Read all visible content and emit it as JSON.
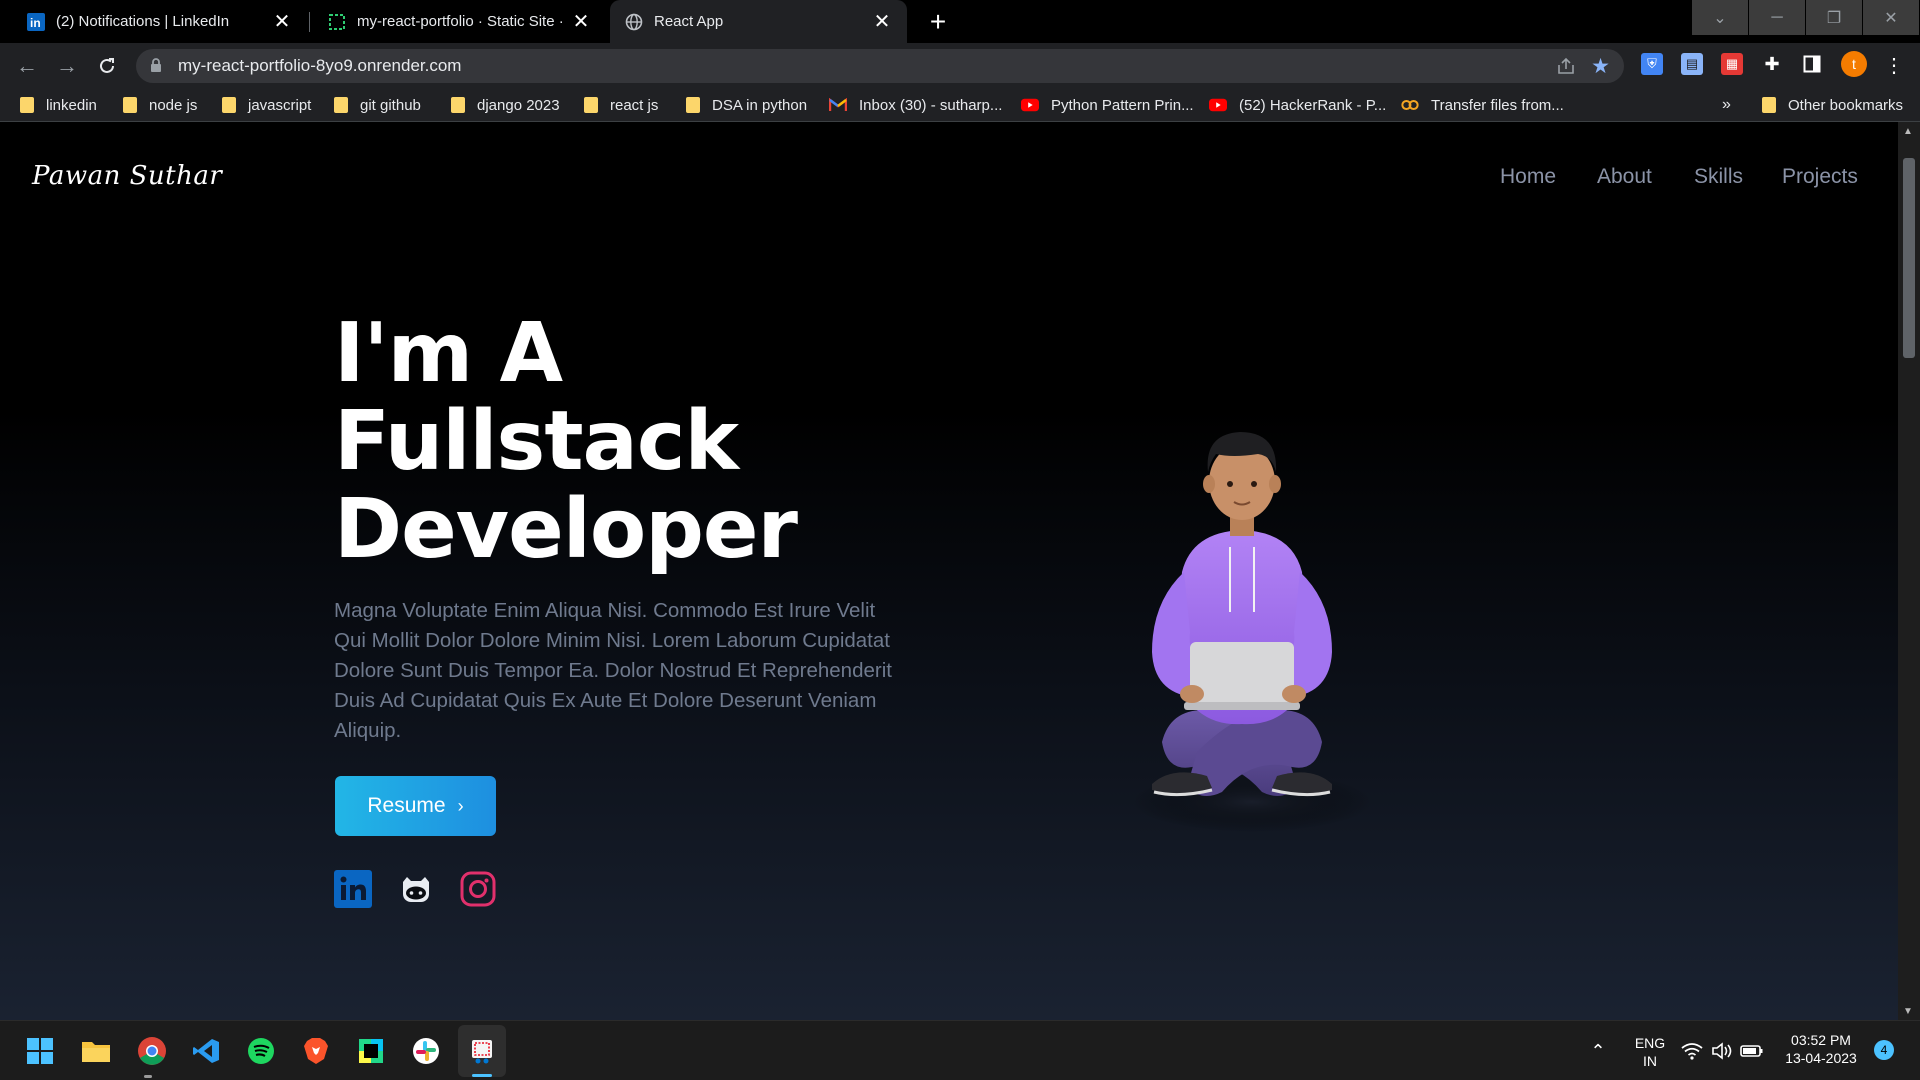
{
  "browser": {
    "tabs": [
      {
        "title": "(2) Notifications | LinkedIn",
        "favicon": "linkedin-icon"
      },
      {
        "title": "my-react-portfolio · Static Site ·",
        "favicon": "render-icon"
      },
      {
        "title": "React App",
        "favicon": "globe-icon"
      }
    ],
    "close_glyph": "✕",
    "new_tab_glyph": "+",
    "url": "my-react-portfolio-8yo9.onrender.com",
    "profile_initial": "t",
    "bookmarks": [
      {
        "label": "linkedin",
        "type": "folder"
      },
      {
        "label": "node js",
        "type": "folder"
      },
      {
        "label": "javascript",
        "type": "folder"
      },
      {
        "label": "git github",
        "type": "folder"
      },
      {
        "label": "django 2023",
        "type": "folder"
      },
      {
        "label": "react js",
        "type": "folder"
      },
      {
        "label": "DSA in python",
        "type": "folder"
      },
      {
        "label": "Inbox (30) - sutharp...",
        "type": "gmail-icon"
      },
      {
        "label": "Python Pattern Prin...",
        "type": "youtube-icon"
      },
      {
        "label": "(52) HackerRank - P...",
        "type": "youtube-icon"
      },
      {
        "label": "Transfer files from...",
        "type": "transfer-icon"
      }
    ],
    "bookmarks_overflow": "»",
    "other_bookmarks": "Other bookmarks"
  },
  "page": {
    "brand": "Pawan Suthar",
    "nav": [
      "Home",
      "About",
      "Skills",
      "Projects"
    ],
    "hero_lines": [
      "I'm A",
      "Fullstack",
      "Developer"
    ],
    "hero_text": "Magna Voluptate Enim Aliqua Nisi. Commodo Est Irure Velit Qui Mollit Dolor Dolore Minim Nisi. Lorem Laborum Cupidatat Dolore Sunt Duis Tempor Ea. Dolor Nostrud Et Reprehenderit Duis Ad Cupidatat Quis Ex Aute Et Dolore Deserunt Veniam Aliquip.",
    "resume_label": "Resume",
    "resume_chevron": "›",
    "social": [
      "linkedin-icon",
      "github-icon",
      "instagram-icon"
    ]
  },
  "taskbar": {
    "apps": [
      "windows-start-icon",
      "file-explorer-icon",
      "chrome-icon",
      "vscode-icon",
      "spotify-icon",
      "brave-icon",
      "pycharm-icon",
      "slack-icon",
      "snipping-tool-icon"
    ],
    "lang_line1": "ENG",
    "lang_line2": "IN",
    "time": "03:52 PM",
    "date": "13-04-2023",
    "notification_count": "4"
  },
  "colors": {
    "accent_button": "#1ea7e4",
    "nav_text": "#8b93a7",
    "body_text": "#6f7a8e",
    "linkedin": "#0a66c2",
    "instagram": "#e1306c",
    "folder": "#fcd66b"
  }
}
